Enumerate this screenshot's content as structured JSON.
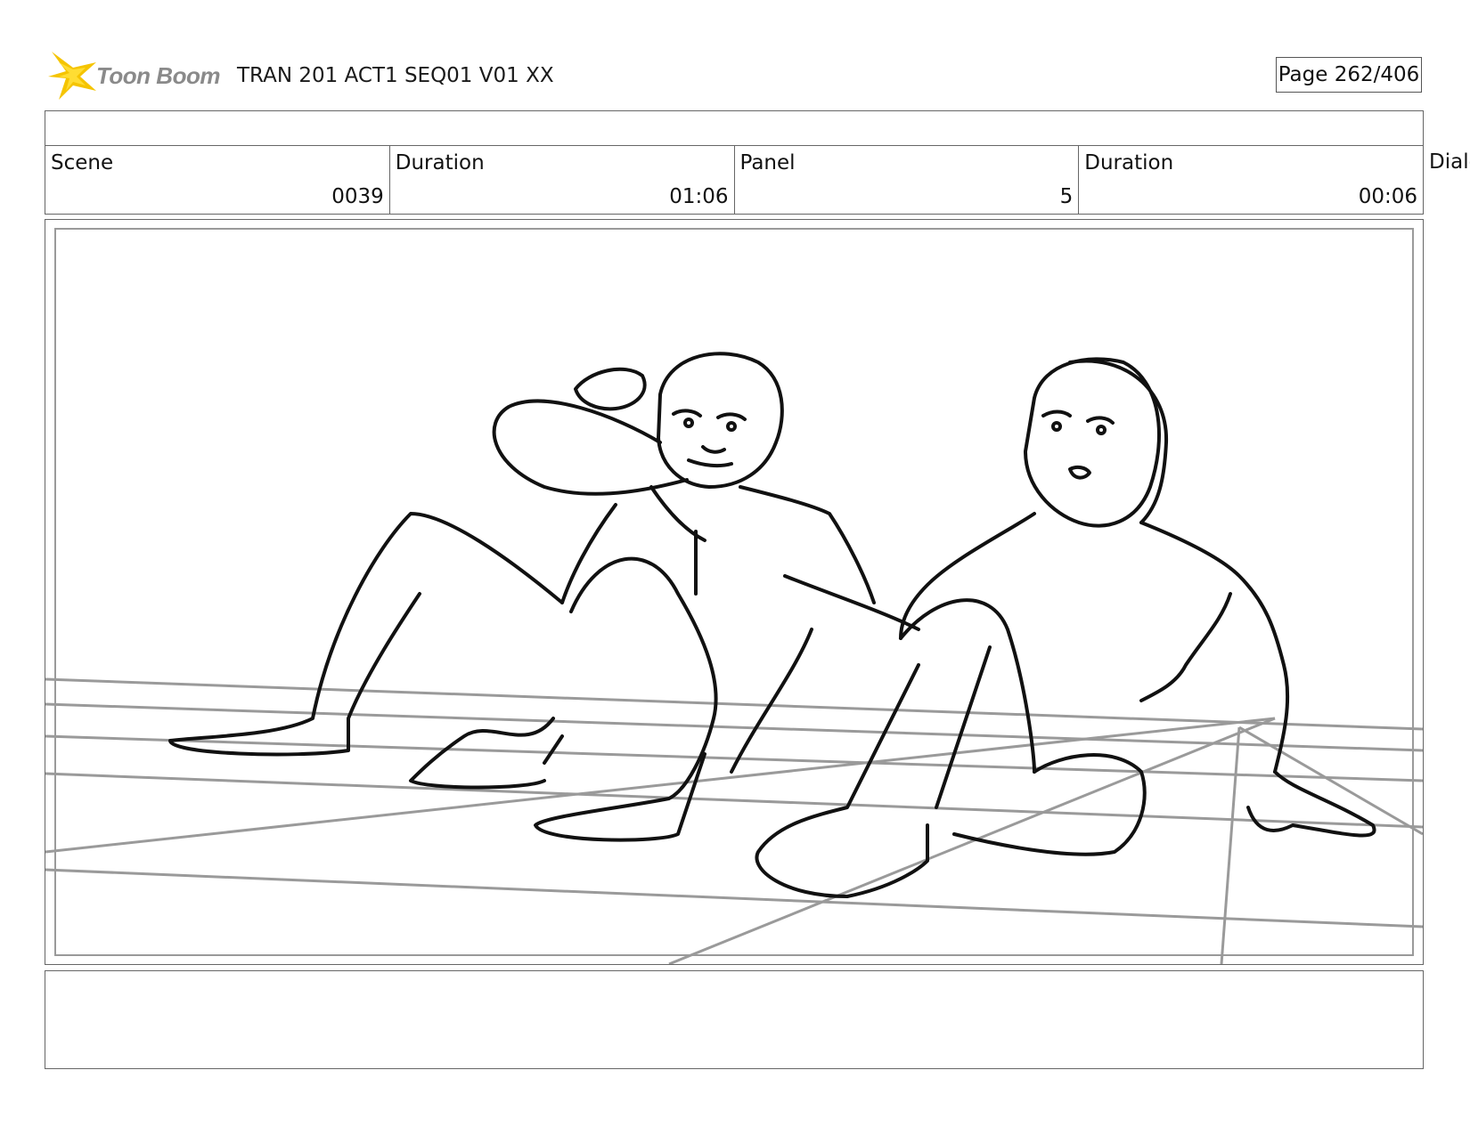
{
  "header": {
    "brand": "Toon Boom",
    "title": "TRAN 201 ACT1 SEQ01 V01 XX",
    "page": "Page 262/406"
  },
  "info": {
    "scene_label": "Scene",
    "scene_value": "0039",
    "scene_duration_label": "Duration",
    "scene_duration_value": "01:06",
    "panel_label": "Panel",
    "panel_value": "5",
    "panel_duration_label": "Duration",
    "panel_duration_value": "00:06",
    "dialog_label": "Dialo"
  },
  "colors": {
    "logo_star": "#f5c400",
    "logo_text": "#8a8a8a"
  }
}
